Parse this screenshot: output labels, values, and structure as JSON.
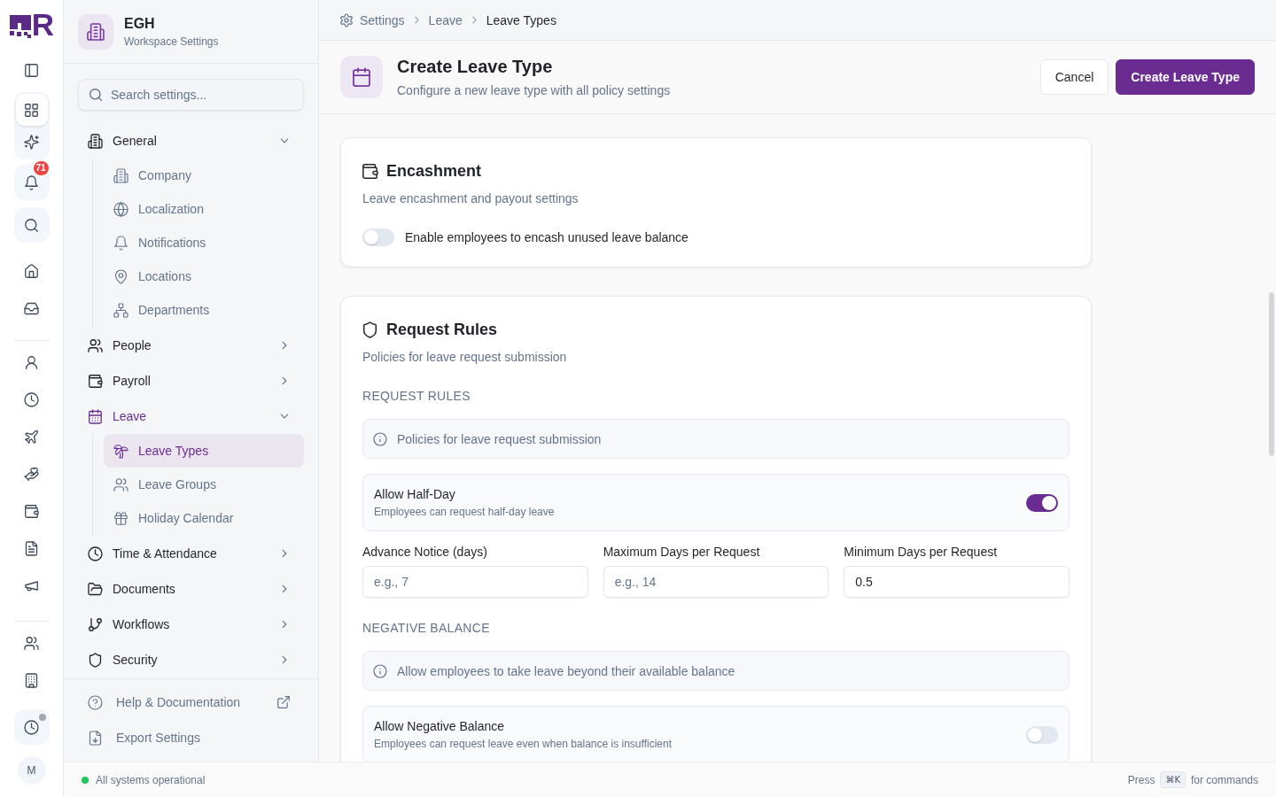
{
  "rail": {
    "logo": "R",
    "sections": [
      {
        "kind": "plain",
        "items": [
          {
            "selected": false,
            "dot": false
          }
        ]
      },
      {
        "kind": "tile",
        "items": [
          {
            "selected": true,
            "dot": false
          },
          {
            "selected": false,
            "dot": false
          }
        ]
      },
      {
        "kind": "tile",
        "items": [
          {
            "selected": false,
            "dot": false,
            "badge": "71"
          }
        ]
      },
      {
        "kind": "tile",
        "items": [
          {
            "selected": false,
            "dot": false
          }
        ]
      },
      {
        "kind": "plain",
        "items": [
          {
            "selected": false,
            "dot": false
          },
          {
            "selected": false,
            "dot": false
          }
        ]
      },
      {
        "kind": "divider"
      },
      {
        "kind": "plain",
        "items": [
          {
            "selected": false,
            "dot": false
          },
          {
            "selected": false,
            "dot": false
          },
          {
            "selected": false,
            "dot": false
          },
          {
            "selected": false,
            "dot": false
          },
          {
            "selected": false,
            "dot": false
          },
          {
            "selected": false,
            "dot": false
          },
          {
            "selected": false,
            "dot": false
          }
        ]
      },
      {
        "kind": "divider"
      },
      {
        "kind": "plain",
        "items": [
          {
            "selected": false,
            "dot": false
          },
          {
            "selected": false,
            "dot": false
          }
        ]
      },
      {
        "kind": "tile",
        "items": [
          {
            "selected": false,
            "dot": true
          }
        ]
      }
    ],
    "avatar": "M"
  },
  "sidebar": {
    "workspace": {
      "name": "EGH",
      "subtitle": "Workspace Settings"
    },
    "search": {
      "placeholder": "Search settings..."
    },
    "nav": [
      {
        "label": "General",
        "active": false,
        "expanded": true,
        "children": [
          {
            "label": "Company",
            "selected": false
          },
          {
            "label": "Localization",
            "selected": false
          },
          {
            "label": "Notifications",
            "selected": false
          },
          {
            "label": "Locations",
            "selected": false
          },
          {
            "label": "Departments",
            "selected": false
          }
        ]
      },
      {
        "label": "People",
        "active": false,
        "expanded": false
      },
      {
        "label": "Payroll",
        "active": false,
        "expanded": false
      },
      {
        "label": "Leave",
        "active": true,
        "expanded": true,
        "children": [
          {
            "label": "Leave Types",
            "selected": true
          },
          {
            "label": "Leave Groups",
            "selected": false
          },
          {
            "label": "Holiday Calendar",
            "selected": false
          }
        ]
      },
      {
        "label": "Time & Attendance",
        "active": false,
        "expanded": false
      },
      {
        "label": "Documents",
        "active": false,
        "expanded": false
      },
      {
        "label": "Workflows",
        "active": false,
        "expanded": false
      },
      {
        "label": "Security",
        "active": false,
        "expanded": false
      }
    ],
    "footer": [
      {
        "label": "Help & Documentation",
        "external": true
      },
      {
        "label": "Export Settings",
        "external": false
      }
    ]
  },
  "breadcrumb": [
    {
      "label": "Settings",
      "current": false
    },
    {
      "label": "Leave",
      "current": false
    },
    {
      "label": "Leave Types",
      "current": true
    }
  ],
  "header": {
    "title": "Create Leave Type",
    "subtitle": "Configure a new leave type with all policy settings",
    "buttons": [
      {
        "label": "Cancel",
        "kind": "secondary"
      },
      {
        "label": "Create Leave Type",
        "kind": "primary"
      }
    ]
  },
  "sections": [
    {
      "title": "Encashment",
      "description": "Leave encashment and payout settings",
      "blocks": [
        {
          "kind": "switch",
          "label": "Enable employees to encash unused leave balance",
          "on": false
        }
      ]
    },
    {
      "title": "Request Rules",
      "description": "Policies for leave request submission",
      "blocks": [
        {
          "kind": "heading",
          "text": "REQUEST RULES"
        },
        {
          "kind": "info",
          "text": "Policies for leave request submission"
        },
        {
          "kind": "toggle_card",
          "label": "Allow Half-Day",
          "hint": "Employees can request half-day leave",
          "on": true
        },
        {
          "kind": "fields",
          "fields": [
            {
              "label": "Advance Notice (days)",
              "placeholder": "e.g., 7"
            },
            {
              "label": "Maximum Days per Request",
              "placeholder": "e.g., 14"
            },
            {
              "label": "Minimum Days per Request",
              "value": "0.5"
            }
          ]
        },
        {
          "kind": "heading",
          "text": "NEGATIVE BALANCE"
        },
        {
          "kind": "info",
          "text": "Allow employees to take leave beyond their available balance"
        },
        {
          "kind": "toggle_card",
          "label": "Allow Negative Balance",
          "hint": "Employees can request leave even when balance is insufficient",
          "on": false
        }
      ]
    }
  ],
  "status_bar": {
    "text": "All systems operational",
    "shortcut_prefix": "Press",
    "shortcut": "⌘K",
    "shortcut_suffix": "for commands"
  }
}
